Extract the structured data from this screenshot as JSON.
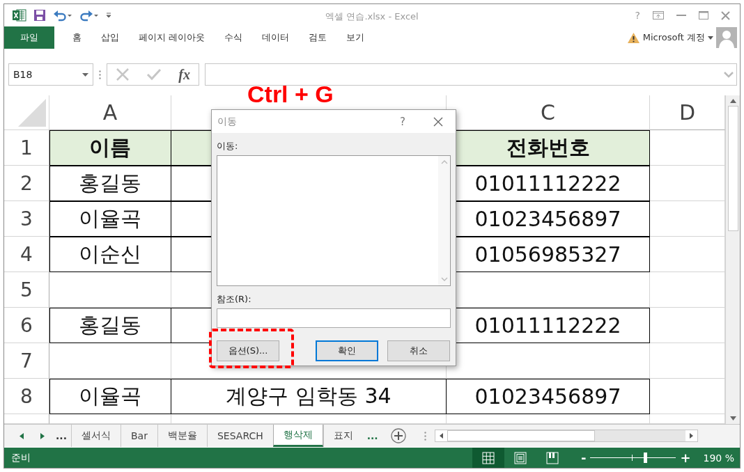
{
  "title_bar": {
    "title": "엑셀 연습.xlsx - Excel",
    "help": "?"
  },
  "ribbon_tabs": [
    {
      "label": "파일",
      "kind": "file"
    },
    {
      "label": "홈",
      "kind": "tab"
    },
    {
      "label": "삽입",
      "kind": "tab"
    },
    {
      "label": "페이지 레이아웃",
      "kind": "tab"
    },
    {
      "label": "수식",
      "kind": "tab"
    },
    {
      "label": "데이터",
      "kind": "tab"
    },
    {
      "label": "검토",
      "kind": "tab"
    },
    {
      "label": "보기",
      "kind": "tab"
    }
  ],
  "account": {
    "label": "Microsoft 계정"
  },
  "name_box": {
    "value": "B18"
  },
  "formula_bar": {
    "function_label": "fx"
  },
  "annotation": {
    "text": "Ctrl + G"
  },
  "columns": [
    {
      "label": "A"
    },
    {},
    {
      "label": "C"
    },
    {
      "label": "D"
    }
  ],
  "rows": [
    {
      "header": "1",
      "kind": "title",
      "cells": [
        "이름",
        null,
        "전화번호",
        null
      ]
    },
    {
      "header": "2",
      "kind": "data",
      "cells": [
        "홍길동",
        null,
        "01011112222",
        null
      ]
    },
    {
      "header": "3",
      "kind": "data",
      "cells": [
        "이율곡",
        null,
        "01023456897",
        null
      ]
    },
    {
      "header": "4",
      "kind": "data",
      "cells": [
        "이순신",
        null,
        "01056985327",
        null
      ]
    },
    {
      "header": "5",
      "kind": "blank",
      "cells": [
        null,
        null,
        null,
        null
      ]
    },
    {
      "header": "6",
      "kind": "data",
      "cells": [
        "홍길동",
        null,
        "01011112222",
        null
      ]
    },
    {
      "header": "7",
      "kind": "blank",
      "cells": [
        null,
        null,
        null,
        null
      ]
    },
    {
      "header": "8",
      "kind": "data",
      "cells": [
        "이율곡",
        "계양구 임학동 34",
        "01023456897",
        null
      ]
    }
  ],
  "dialog": {
    "title": "이동",
    "help": "?",
    "goto_label": "이동:",
    "reference_label": "참조(R):",
    "buttons": [
      {
        "label": "옵션(S)...",
        "kind": "normal",
        "annotated": true
      },
      {
        "label": "확인",
        "kind": "default",
        "annotated": false
      },
      {
        "label": "취소",
        "kind": "normal",
        "annotated": false
      }
    ]
  },
  "sheet_tabs": {
    "more_left": "...",
    "more_right": "...",
    "tabs": [
      {
        "label": "셀서식",
        "selected": false
      },
      {
        "label": "Bar",
        "selected": false
      },
      {
        "label": "백분율",
        "selected": false
      },
      {
        "label": "SESARCH",
        "selected": false
      },
      {
        "label": "행삭제",
        "selected": true
      },
      {
        "label": "표지",
        "selected": false
      }
    ]
  },
  "status_bar": {
    "text": "준비",
    "views": [
      {
        "kind": "normal",
        "selected": true
      },
      {
        "kind": "page_layout",
        "selected": false
      },
      {
        "kind": "page_break",
        "selected": false
      }
    ],
    "zoom": {
      "minus": "-",
      "plus": "+",
      "level": 0.64,
      "reading": "190 %"
    }
  }
}
